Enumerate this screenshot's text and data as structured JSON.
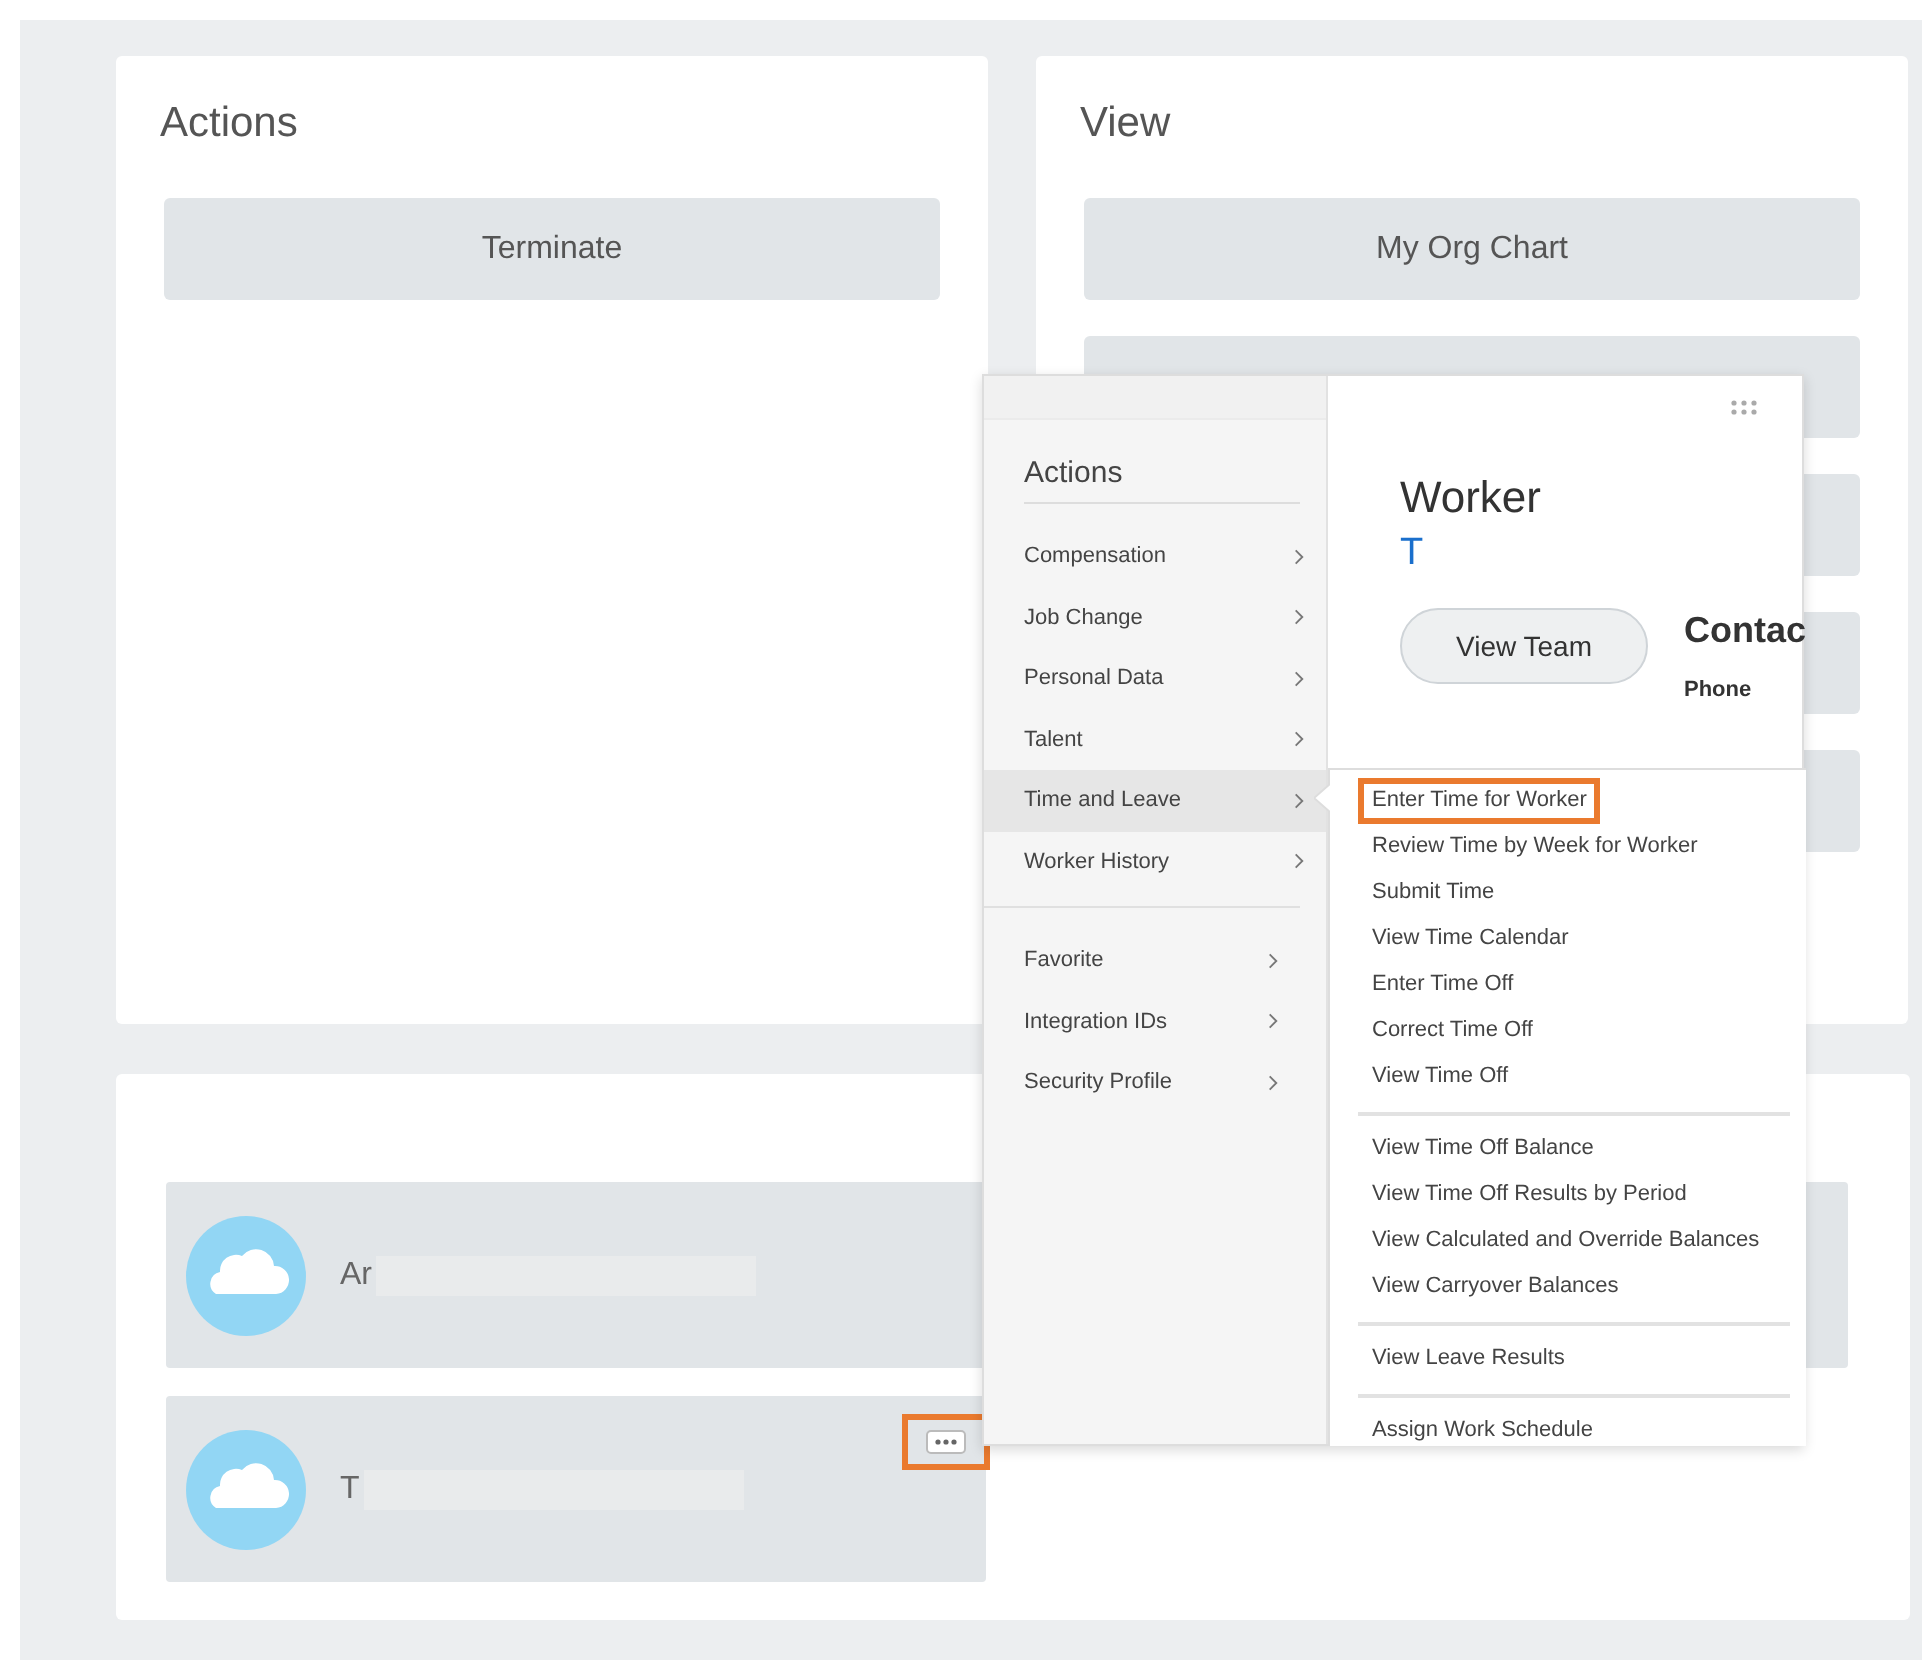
{
  "actions_card": {
    "title": "Actions",
    "buttons": [
      {
        "kind": "label",
        "label": "Terminate"
      }
    ]
  },
  "view_card": {
    "title": "View",
    "buttons": [
      {
        "kind": "label",
        "label": "My Org Chart"
      },
      {
        "kind": "covered"
      },
      {
        "kind": "covered"
      },
      {
        "kind": "covered"
      },
      {
        "kind": "covered"
      }
    ]
  },
  "people": [
    {
      "name": "Ar",
      "redacted": true,
      "more_button": false
    },
    {
      "name": "T",
      "redacted": true,
      "more_button": true,
      "more_highlighted": true
    }
  ],
  "popup": {
    "menu_title": "Actions",
    "menu_groups": [
      [
        {
          "label": "Compensation",
          "selected": false
        },
        {
          "label": "Job Change",
          "selected": false
        },
        {
          "label": "Personal Data",
          "selected": false
        },
        {
          "label": "Talent",
          "selected": false
        },
        {
          "label": "Time and Leave",
          "selected": true
        },
        {
          "label": "Worker History",
          "selected": false
        }
      ],
      [
        {
          "label": "Favorite",
          "selected": false
        },
        {
          "label": "Integration IDs",
          "selected": false
        },
        {
          "label": "Security Profile",
          "selected": false
        }
      ]
    ],
    "worker": {
      "heading": "Worker",
      "name": "T",
      "button": "View Team",
      "contact_heading": "Contac",
      "phone_label": "Phone"
    },
    "submenu_groups": [
      [
        {
          "label": "Enter Time for Worker",
          "highlighted": true
        },
        {
          "label": "Review Time by Week for Worker",
          "highlighted": false
        },
        {
          "label": "Submit Time",
          "highlighted": false
        },
        {
          "label": "View Time Calendar",
          "highlighted": false
        },
        {
          "label": "Enter Time Off",
          "highlighted": false
        },
        {
          "label": "Correct Time Off",
          "highlighted": false
        },
        {
          "label": "View Time Off",
          "highlighted": false
        }
      ],
      [
        {
          "label": "View Time Off Balance",
          "highlighted": false
        },
        {
          "label": "View Time Off Results by Period",
          "highlighted": false
        },
        {
          "label": "View Calculated and Override Balances",
          "highlighted": false
        },
        {
          "label": "View Carryover Balances",
          "highlighted": false
        }
      ],
      [
        {
          "label": "View Leave Results",
          "highlighted": false
        }
      ],
      [
        {
          "label": "Assign Work Schedule",
          "highlighted": false
        }
      ]
    ]
  }
}
